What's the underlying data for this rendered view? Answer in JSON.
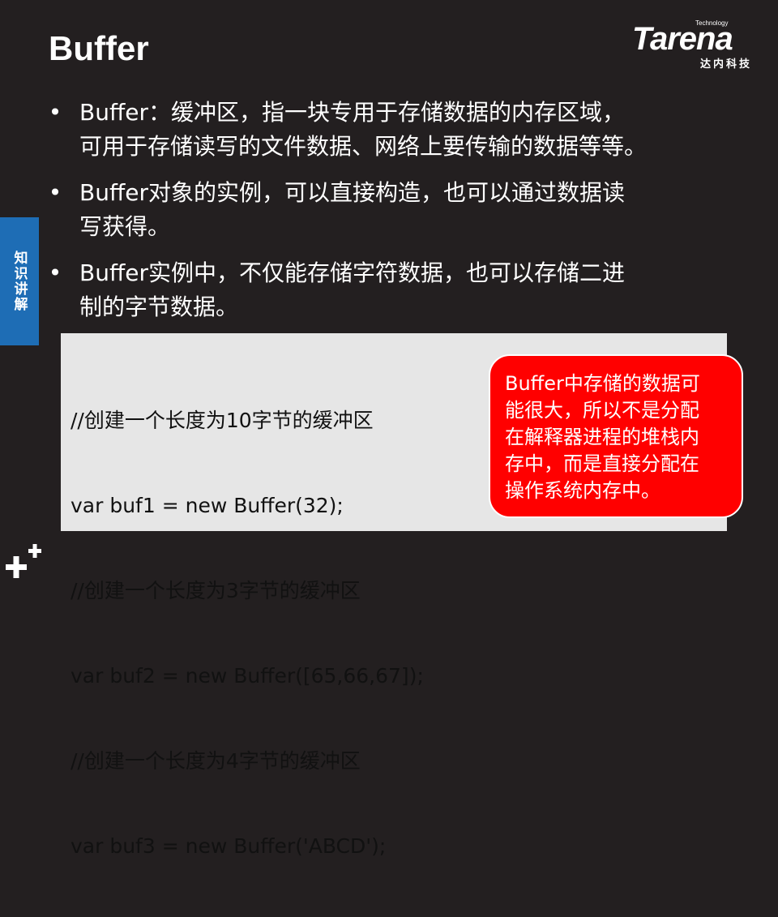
{
  "slide": {
    "title": "Buffer",
    "side_tab": "知识讲解"
  },
  "logo": {
    "tagline": "Technology",
    "wordmark": "Tarena",
    "chinese_name": "达内科技"
  },
  "bullets": [
    {
      "marker": "•",
      "lines": [
        "Buffer：缓冲区，指一块专用于存储数据的内存区域，",
        "可用于存储读写的文件数据、网络上要传输的数据等等。"
      ]
    },
    {
      "marker": "•",
      "lines": [
        "Buffer对象的实例，可以直接构造，也可以通过数据读",
        "写获得。"
      ]
    },
    {
      "marker": "•",
      "lines": [
        "Buffer实例中，不仅能存储字符数据，也可以存储二进",
        "制的字节数据。"
      ]
    }
  ],
  "code": {
    "lines": [
      "//创建一个长度为10字节的缓冲区",
      "var buf1 = new Buffer(32);",
      "//创建一个长度为3字节的缓冲区",
      "var buf2 = new Buffer([65,66,67]);",
      "//创建一个长度为4字节的缓冲区",
      "var buf3 = new Buffer('ABCD');"
    ]
  },
  "callout": {
    "lines": [
      "Buffer中存储的数据可",
      "能很大，所以不是分配",
      "在解释器进程的堆栈内",
      "存中，而是直接分配在",
      "操作系统内存中。"
    ]
  },
  "colors": {
    "background": "#231f20",
    "side_tab": "#1e6db5",
    "callout": "#ff0000",
    "code_box": "#e6e6e6"
  },
  "icons": {
    "corner_mark": "plus-plus-icon"
  }
}
